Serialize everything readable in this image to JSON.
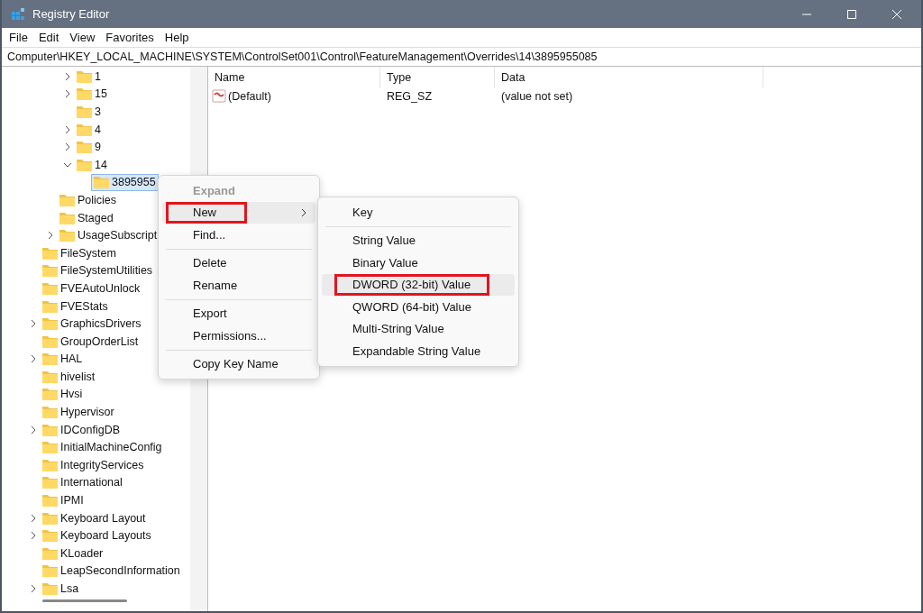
{
  "window": {
    "title": "Registry Editor"
  },
  "menu_bar": [
    "File",
    "Edit",
    "View",
    "Favorites",
    "Help"
  ],
  "address": "Computer\\HKEY_LOCAL_MACHINE\\SYSTEM\\ControlSet001\\Control\\FeatureManagement\\Overrides\\14\\3895955085",
  "tree": {
    "children": [
      {
        "children": [
          {
            "children": [
              {
                "label": "1",
                "has_children": true,
                "expanded": false,
                "selected": false
              },
              {
                "label": "15",
                "has_children": true,
                "expanded": false,
                "selected": false
              },
              {
                "label": "3",
                "has_children": false,
                "selected": false
              },
              {
                "label": "4",
                "has_children": true,
                "expanded": false,
                "selected": false
              },
              {
                "label": "9",
                "has_children": true,
                "expanded": false,
                "selected": false
              },
              {
                "label": "14",
                "has_children": true,
                "expanded": true,
                "selected": false,
                "children": [
                  {
                    "label": "3895955",
                    "has_children": false,
                    "selected": true
                  }
                ]
              }
            ]
          },
          {
            "label": "Policies",
            "has_children": false,
            "selected": false
          },
          {
            "label": "Staged",
            "has_children": false,
            "selected": false
          },
          {
            "label": "UsageSubscript",
            "has_children": true,
            "expanded": false,
            "selected": false
          }
        ]
      },
      {
        "label": "FileSystem",
        "has_children": false,
        "selected": false
      },
      {
        "label": "FileSystemUtilities",
        "has_children": false,
        "selected": false
      },
      {
        "label": "FVEAutoUnlock",
        "has_children": false,
        "selected": false
      },
      {
        "label": "FVEStats",
        "has_children": false,
        "selected": false
      },
      {
        "label": "GraphicsDrivers",
        "has_children": true,
        "expanded": false,
        "selected": false
      },
      {
        "label": "GroupOrderList",
        "has_children": false,
        "selected": false
      },
      {
        "label": "HAL",
        "has_children": true,
        "expanded": false,
        "selected": false
      },
      {
        "label": "hivelist",
        "has_children": false,
        "selected": false
      },
      {
        "label": "Hvsi",
        "has_children": false,
        "selected": false
      },
      {
        "label": "Hypervisor",
        "has_children": false,
        "selected": false
      },
      {
        "label": "IDConfigDB",
        "has_children": true,
        "expanded": false,
        "selected": false
      },
      {
        "label": "InitialMachineConfig",
        "has_children": false,
        "selected": false
      },
      {
        "label": "IntegrityServices",
        "has_children": false,
        "selected": false
      },
      {
        "label": "International",
        "has_children": false,
        "selected": false
      },
      {
        "label": "IPMI",
        "has_children": false,
        "selected": false
      },
      {
        "label": "Keyboard Layout",
        "has_children": true,
        "expanded": false,
        "selected": false
      },
      {
        "label": "Keyboard Layouts",
        "has_children": true,
        "expanded": false,
        "selected": false
      },
      {
        "label": "KLoader",
        "has_children": false,
        "selected": false
      },
      {
        "label": "LeapSecondInformation",
        "has_children": false,
        "selected": false
      },
      {
        "label": "Lsa",
        "has_children": true,
        "expanded": false,
        "selected": false
      }
    ]
  },
  "values": {
    "columns": [
      "Name",
      "Type",
      "Data"
    ],
    "rows": [
      {
        "name": "(Default)",
        "type": "REG_SZ",
        "data": "(value not set)"
      }
    ]
  },
  "context_menu": [
    {
      "kind": "item",
      "label": "Expand",
      "disabled": true,
      "hovered": false,
      "highlighted": false,
      "submenu": false
    },
    {
      "kind": "item",
      "label": "New",
      "disabled": false,
      "hovered": true,
      "highlighted": true,
      "submenu": true
    },
    {
      "kind": "item",
      "label": "Find...",
      "disabled": false,
      "hovered": false,
      "highlighted": false,
      "submenu": false
    },
    {
      "kind": "separator"
    },
    {
      "kind": "item",
      "label": "Delete",
      "disabled": false,
      "hovered": false,
      "highlighted": false,
      "submenu": false
    },
    {
      "kind": "item",
      "label": "Rename",
      "disabled": false,
      "hovered": false,
      "highlighted": false,
      "submenu": false
    },
    {
      "kind": "separator"
    },
    {
      "kind": "item",
      "label": "Export",
      "disabled": false,
      "hovered": false,
      "highlighted": false,
      "submenu": false
    },
    {
      "kind": "item",
      "label": "Permissions...",
      "disabled": false,
      "hovered": false,
      "highlighted": false,
      "submenu": false
    },
    {
      "kind": "separator"
    },
    {
      "kind": "item",
      "label": "Copy Key Name",
      "disabled": false,
      "hovered": false,
      "highlighted": false,
      "submenu": false
    }
  ],
  "submenu": [
    {
      "kind": "item",
      "label": "Key",
      "hovered": false,
      "highlighted": false
    },
    {
      "kind": "separator"
    },
    {
      "kind": "item",
      "label": "String Value",
      "hovered": false,
      "highlighted": false
    },
    {
      "kind": "item",
      "label": "Binary Value",
      "hovered": false,
      "highlighted": false
    },
    {
      "kind": "item",
      "label": "DWORD (32-bit) Value",
      "hovered": true,
      "highlighted": true
    },
    {
      "kind": "item",
      "label": "QWORD (64-bit) Value",
      "hovered": false,
      "highlighted": false
    },
    {
      "kind": "item",
      "label": "Multi-String Value",
      "hovered": false,
      "highlighted": false
    },
    {
      "kind": "item",
      "label": "Expandable String Value",
      "hovered": false,
      "highlighted": false
    }
  ]
}
